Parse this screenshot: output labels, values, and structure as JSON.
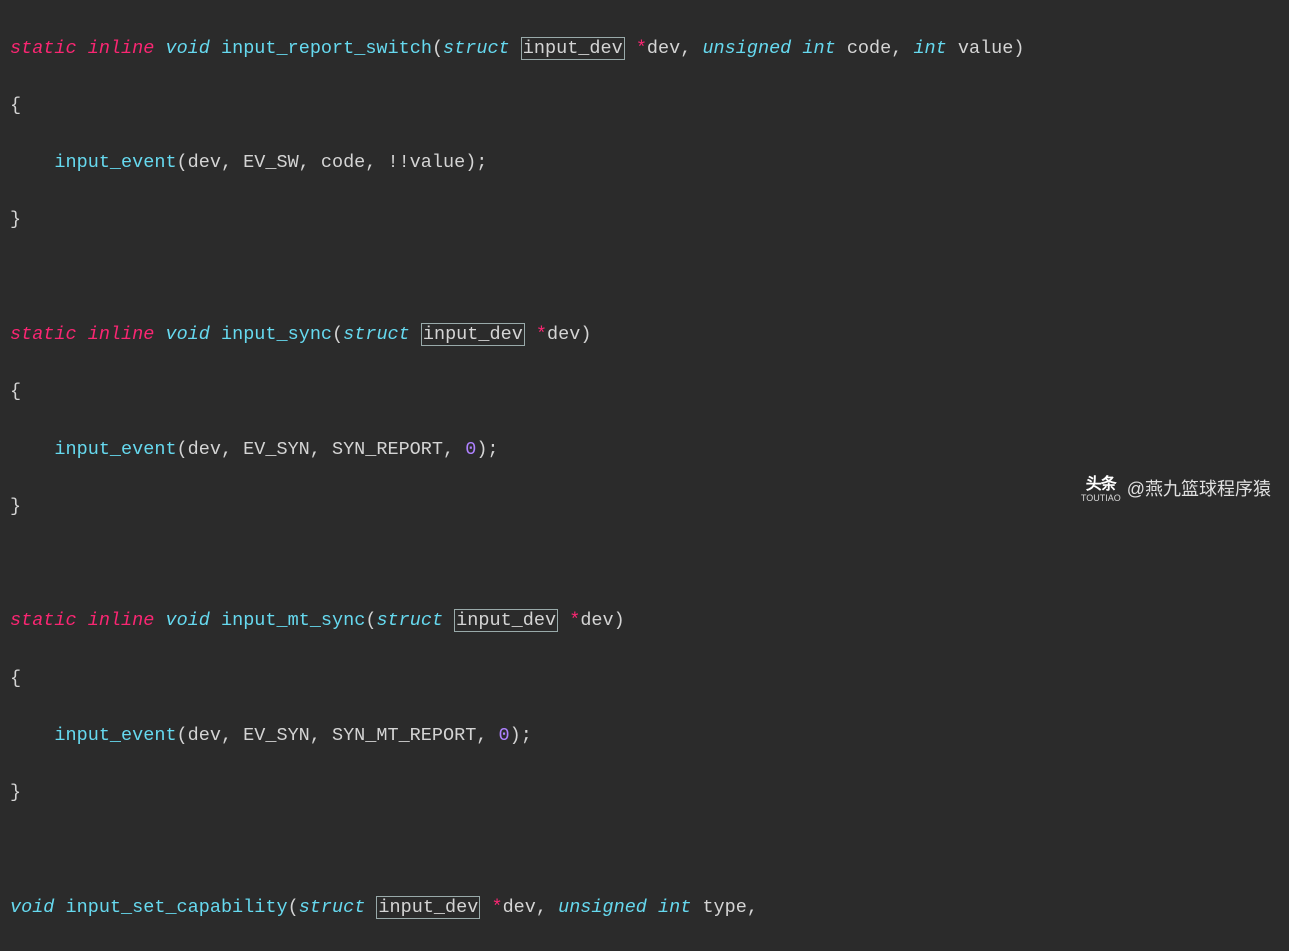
{
  "code": {
    "s": "static",
    "i": "inline",
    "v": "void",
    "st": "struct",
    "idev": "input_dev",
    "u": "unsigned",
    "int": "int",
    "star": "*",
    "f1": {
      "name": "input_report_switch",
      "p_dev": "dev",
      "p_code": "code",
      "p_value": "value",
      "body_fn": "input_event",
      "body_args": "(dev, EV_SW, code, !!value);"
    },
    "f2": {
      "name": "input_sync",
      "p_dev": "dev",
      "body_fn": "input_event",
      "body_a": "(dev, EV_SYN, SYN_REPORT, ",
      "body_n": "0",
      "body_b": ");"
    },
    "f3": {
      "name": "input_mt_sync",
      "p_dev": "dev",
      "body_fn": "input_event",
      "body_a": "(dev, EV_SYN, SYN_MT_REPORT, ",
      "body_n": "0",
      "body_b": ");"
    },
    "f4": {
      "name": "input_set_capability",
      "p_dev": "dev",
      "p_type": "type",
      "trail": "…"
    },
    "ob": "{",
    "cb": "}"
  },
  "watermark": {
    "logo_top": "头条",
    "logo_bot": "TOUTIAO",
    "text": "@燕九篮球程序猿"
  }
}
